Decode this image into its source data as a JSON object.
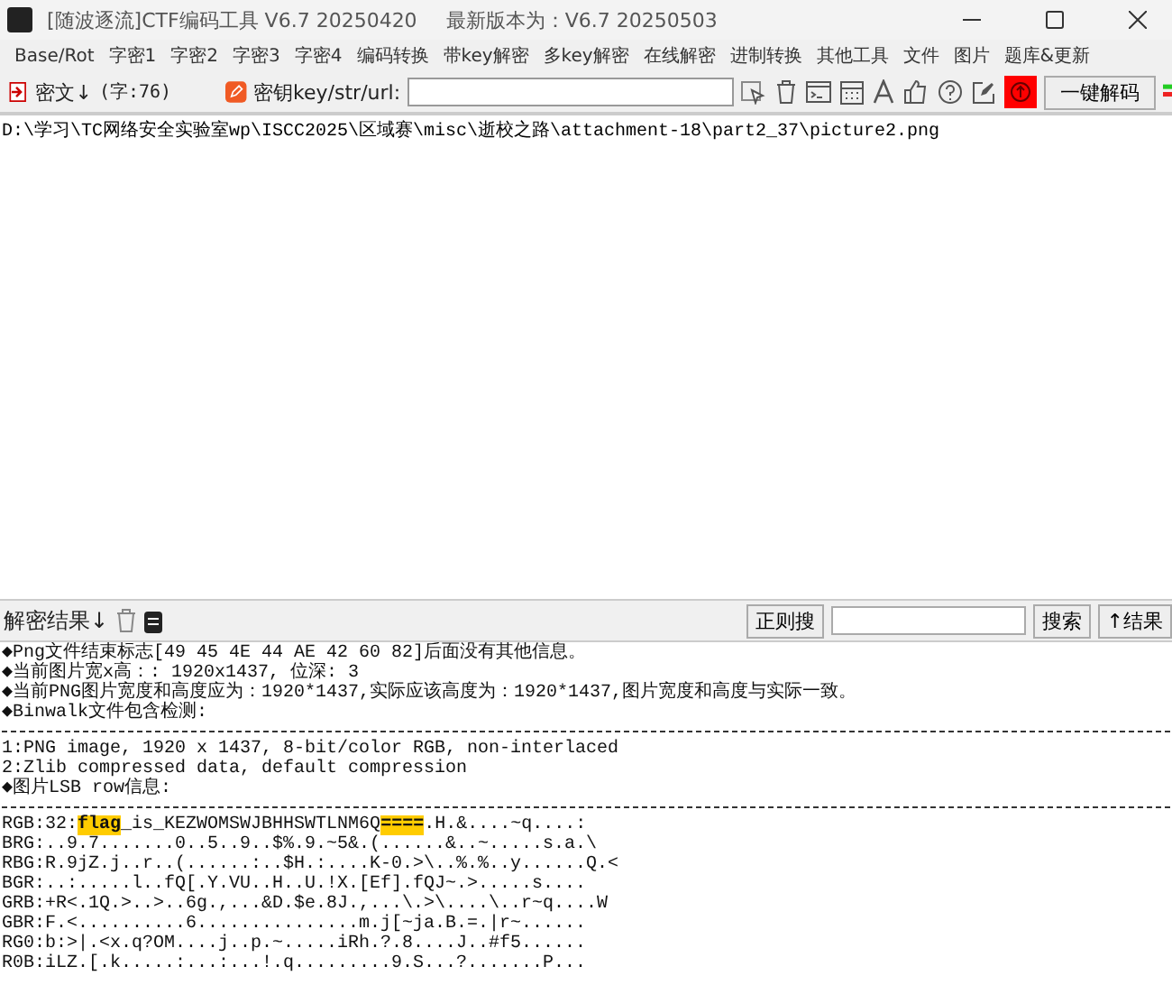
{
  "window": {
    "title": "[随波逐流]CTF编码工具 V6.7 20250420",
    "update_note": "最新版本为：V6.7  20250503"
  },
  "menu": [
    "Base/Rot",
    "字密1",
    "字密2",
    "字密3",
    "字密4",
    "编码转换",
    "带key解密",
    "多key解密",
    "在线解密",
    "进制转换",
    "其他工具",
    "文件",
    "图片",
    "题库&更新"
  ],
  "toolbar": {
    "cipher_label": "密文↓",
    "char_count": "(字:76)",
    "key_label": "密钥key/str/url:",
    "decode_button": "一键解码"
  },
  "cipher_text": "D:\\学习\\TC网络安全实验室wp\\ISCC2025\\区域赛\\misc\\逝校之路\\attachment-18\\part2_37\\picture2.png",
  "result_bar": {
    "label": "解密结果↓",
    "regex_button": "正则搜",
    "search_button": "搜索",
    "result_button": "↑结果"
  },
  "output": [
    {
      "kind": "text",
      "text": "◆Png文件结束标志[49 45 4E 44 AE 42 60 82]后面没有其他信息。"
    },
    {
      "kind": "text",
      "text": "◆当前图片宽x高：: 1920x1437, 位深: 3"
    },
    {
      "kind": "text",
      "text": "◆当前PNG图片宽度和高度应为：1920*1437,实际应该高度为：1920*1437,图片宽度和高度与实际一致。"
    },
    {
      "kind": "text",
      "text": "◆Binwalk文件包含检测:"
    },
    {
      "kind": "divider"
    },
    {
      "kind": "text",
      "text": "1:PNG image, 1920 x 1437, 8-bit/color RGB, non-interlaced"
    },
    {
      "kind": "text",
      "text": "2:Zlib compressed data, default compression"
    },
    {
      "kind": "text",
      "text": "◆图片LSB row信息:"
    },
    {
      "kind": "divider"
    },
    {
      "kind": "segments",
      "parts": [
        {
          "text": "RGB:32:",
          "highlight": false
        },
        {
          "text": "flag",
          "highlight": true
        },
        {
          "text": "_is_KEZWOMSWJBHHSWTLNM6Q",
          "highlight": false
        },
        {
          "text": "====",
          "highlight": true
        },
        {
          "text": ".H.&....~q....:",
          "highlight": false
        }
      ]
    },
    {
      "kind": "text",
      "text": "BRG:..9.7.......0..5..9..$%.9.~5&.(......&..~.....s.a.\\"
    },
    {
      "kind": "text",
      "text": "RBG:R.9jZ.j..r..(......:..$H.:....K-0.>\\..%.%..y......Q.<"
    },
    {
      "kind": "text",
      "text": "BGR:..:.....l..fQ[.Y.VU..H..U.!X.[Ef].fQJ~.>.....s...."
    },
    {
      "kind": "text",
      "text": "GRB:+R<.1Q.>..>..6g.,...&D.$e.8J.,...\\.>\\....\\..r~q....W"
    },
    {
      "kind": "text",
      "text": "GBR:F.<..........6...............m.j[~ja.B.=.|r~......"
    },
    {
      "kind": "text",
      "text": "RG0:b:>|.<x.q?OM....j..p.~.....iRh.?.8....J..#f5......"
    },
    {
      "kind": "text",
      "text": "R0B:iLZ.[.k.....:...:...!.q.........9.S...?.......P..."
    }
  ]
}
